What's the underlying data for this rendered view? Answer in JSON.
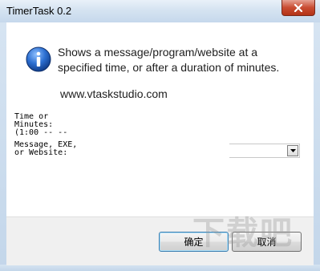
{
  "window": {
    "title": "TimerTask 0.2"
  },
  "message": {
    "text": "Shows a message/program/website at a specified time, or after a duration of minutes.",
    "website": "www.vtaskstudio.com"
  },
  "form": {
    "time_label": "Time or\nMinutes:\n(1:00 -- --",
    "message_label": "Message, EXE,\nor Website:",
    "message_value": ""
  },
  "buttons": {
    "ok_label": "确定",
    "cancel_label": "取消"
  },
  "watermark": {
    "text": "下载吧"
  },
  "colors": {
    "info_blue": "#1f5fbf",
    "close_red": "#c94c32"
  }
}
